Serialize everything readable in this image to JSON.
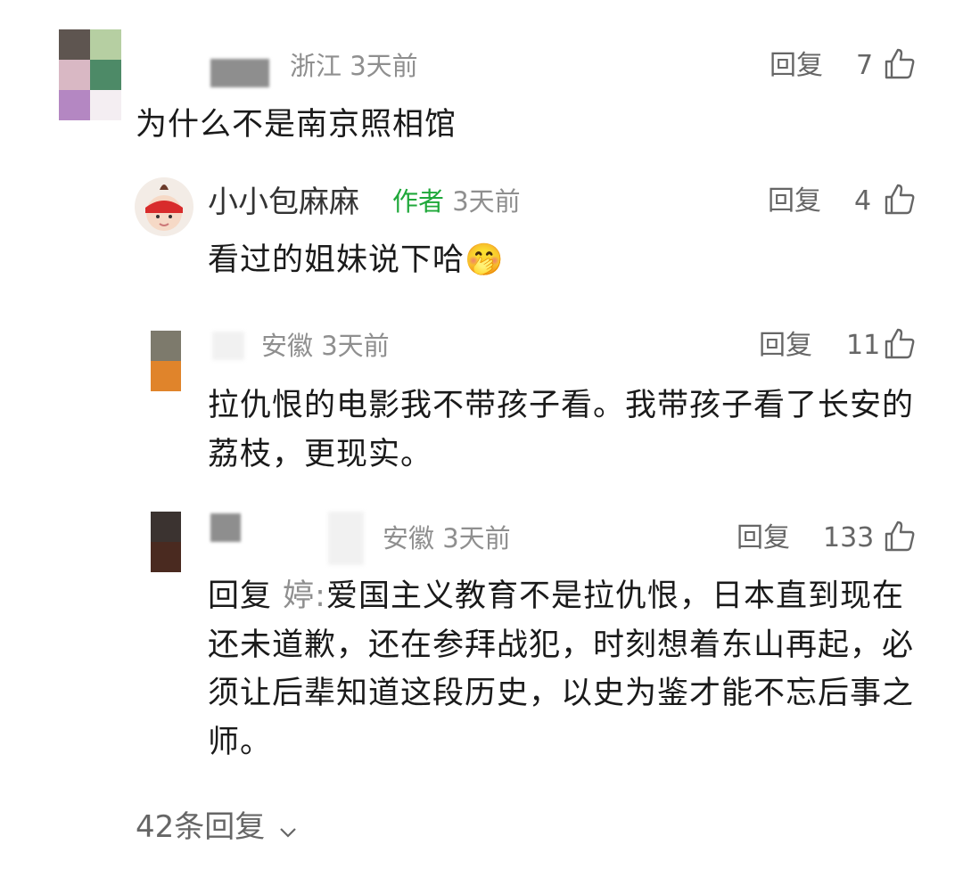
{
  "comments": [
    {
      "region": "浙江",
      "time": "3天前",
      "reply_label": "回复",
      "likes": "7",
      "text": "为什么不是南京照相馆",
      "avatar_colors": [
        "#5e5550",
        "#b6cfa2",
        "#d9b8c4",
        "#4d8a67",
        "#b487c2",
        "#f4eef2"
      ]
    },
    {
      "name": "小小包麻麻",
      "author_tag": "作者",
      "time": "3天前",
      "reply_label": "回复",
      "likes": "4",
      "text": "看过的姐妹说下哈",
      "emoji": "🤭"
    },
    {
      "region": "安徽",
      "time": "3天前",
      "reply_label": "回复",
      "likes": "11",
      "text": "拉仇恨的电影我不带孩子看。我带孩子看了长安的荔枝，更现实。",
      "avatar_colors": [
        "#7d7a6c",
        "#e0842b"
      ]
    },
    {
      "region": "安徽",
      "time": "3天前",
      "reply_label": "回复",
      "likes": "133",
      "reply_prefix": "回复",
      "reply_to": "婷:",
      "text": "爱国主义教育不是拉仇恨，日本直到现在还未道歉，还在参拜战犯，时刻想着东山再起，必须让后辈知道这段历史，以史为鉴才能不忘后事之师。",
      "avatar_colors": [
        "#3b3330",
        "#4a2a20"
      ]
    }
  ],
  "more_replies": "42条回复",
  "icons": {
    "thumb": "thumbs-up-icon",
    "chevron": "chevron-down-icon"
  },
  "colors": {
    "author_tag": "#1fa83a",
    "meta": "#8f8f8f",
    "text": "#1a1a1a"
  }
}
